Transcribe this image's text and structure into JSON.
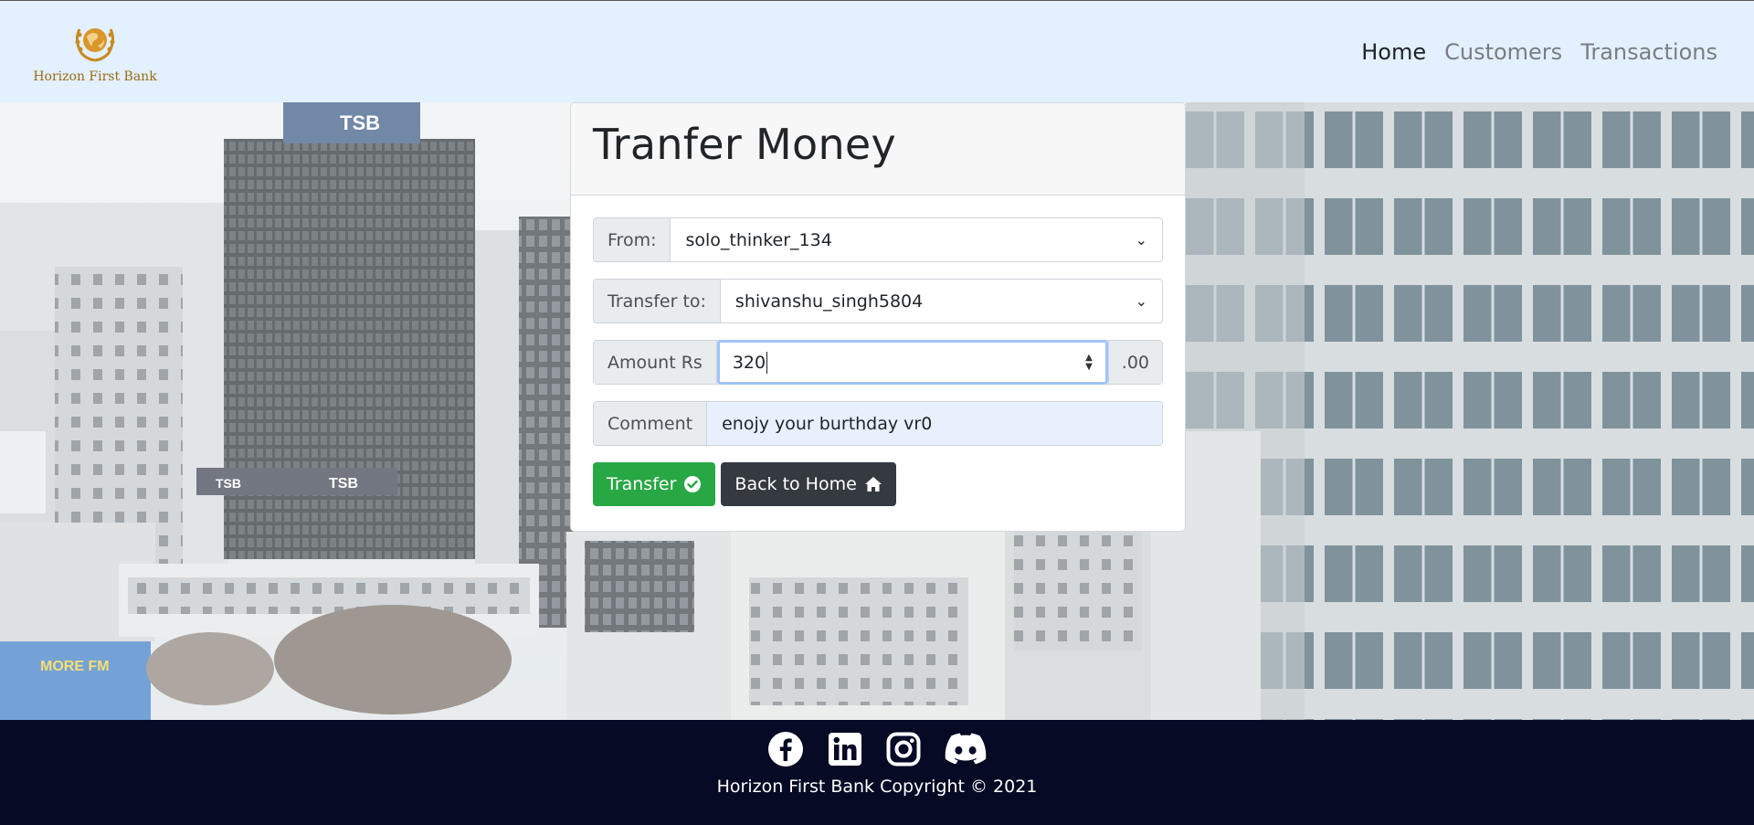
{
  "brand": {
    "name": "Horizon First Bank",
    "color": "#9a6b14"
  },
  "nav": [
    {
      "label": "Home",
      "active": true
    },
    {
      "label": "Customers",
      "active": false
    },
    {
      "label": "Transactions",
      "active": false
    }
  ],
  "hero": {
    "signs": [
      "TSB",
      "TSB",
      "TSB",
      "MORE FM"
    ]
  },
  "form": {
    "title": "Tranfer Money",
    "from_label": "From:",
    "from_value": "solo_thinker_134",
    "to_label": "Transfer to:",
    "to_value": "shivanshu_singh5804",
    "amount_label": "Amount Rs",
    "amount_value": "320",
    "amount_suffix": ".00",
    "comment_label": "Comment",
    "comment_value": "enojy your burthday vr0",
    "transfer_button": "Transfer",
    "back_button": "Back to Home"
  },
  "footer": {
    "icons": [
      "facebook-icon",
      "linkedin-icon",
      "instagram-icon",
      "discord-icon"
    ],
    "copyright": "Horizon First Bank Copyright © 2021"
  },
  "colors": {
    "navbar_bg": "#e2f0ff",
    "footer_bg": "#050a25",
    "success": "#28a745",
    "dark": "#343a40"
  }
}
